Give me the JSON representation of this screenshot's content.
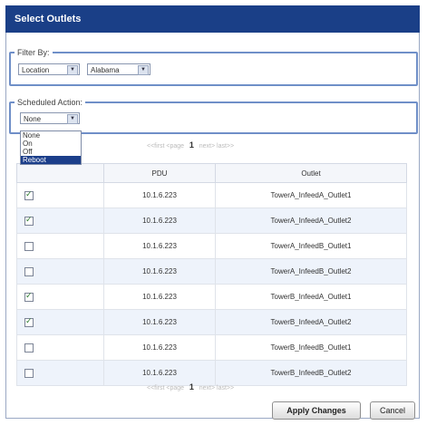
{
  "window": {
    "title": "Select Outlets"
  },
  "filter": {
    "legend": "Filter By:",
    "field_value": "Location",
    "location_value": "Alabama"
  },
  "scheduled_action": {
    "legend": "Scheduled Action:",
    "selected_value": "None",
    "options": [
      "None",
      "On",
      "Off",
      "Reboot"
    ],
    "highlighted_option": "Reboot"
  },
  "pager_top": {
    "prev": "<<first <page",
    "current": "1",
    "next": "next> last>>"
  },
  "table": {
    "columns": [
      "",
      "PDU",
      "Outlet"
    ],
    "rows": [
      {
        "checked": true,
        "pdu": "10.1.6.223",
        "outlet": "TowerA_InfeedA_Outlet1"
      },
      {
        "checked": true,
        "pdu": "10.1.6.223",
        "outlet": "TowerA_InfeedA_Outlet2"
      },
      {
        "checked": false,
        "pdu": "10.1.6.223",
        "outlet": "TowerA_InfeedB_Outlet1"
      },
      {
        "checked": false,
        "pdu": "10.1.6.223",
        "outlet": "TowerA_InfeedB_Outlet2"
      },
      {
        "checked": true,
        "pdu": "10.1.6.223",
        "outlet": "TowerB_InfeedA_Outlet1"
      },
      {
        "checked": true,
        "pdu": "10.1.6.223",
        "outlet": "TowerB_InfeedA_Outlet2"
      },
      {
        "checked": false,
        "pdu": "10.1.6.223",
        "outlet": "TowerB_InfeedB_Outlet1"
      },
      {
        "checked": false,
        "pdu": "10.1.6.223",
        "outlet": "TowerB_InfeedB_Outlet2"
      }
    ]
  },
  "pager_bottom": {
    "prev": "<<first <page",
    "current": "1",
    "next": "next> last>>"
  },
  "buttons": {
    "apply": "Apply Changes",
    "cancel": "Cancel"
  },
  "colors": {
    "title_bar": "#1a3f87",
    "group_border": "#6f8fc8",
    "highlight": "#1b3e8a",
    "row_alt": "#eef3fb"
  }
}
